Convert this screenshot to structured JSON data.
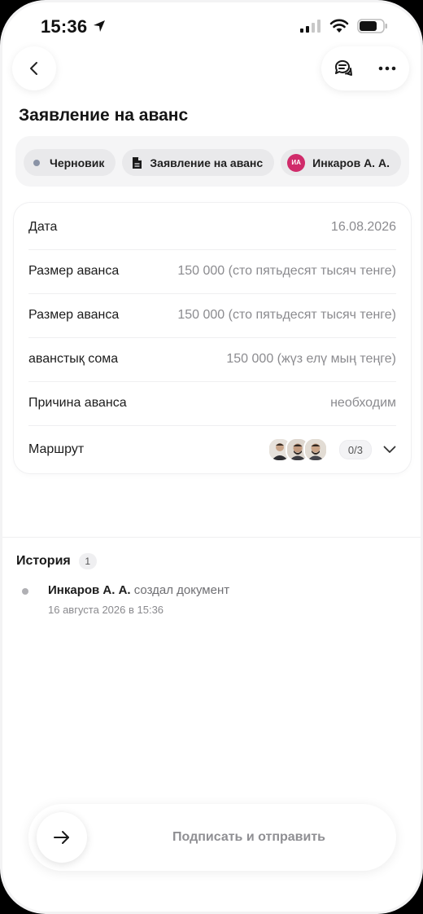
{
  "status_bar": {
    "time": "15:36"
  },
  "header": {
    "title": "Заявление на аванс"
  },
  "chips": {
    "status": "Черновик",
    "doc_type": "Заявление на аванс",
    "author_initials": "ИА",
    "author": "Инкаров А. А."
  },
  "details": {
    "rows": [
      {
        "label": "Дата",
        "value": "16.08.2026"
      },
      {
        "label": "Размер аванса",
        "value": "150 000 (сто пятьдесят тысяч тенге)"
      },
      {
        "label": "Размер аванса",
        "value": "150 000 (сто пятьдесят тысяч тенге)"
      },
      {
        "label": "аванстық сома",
        "value": "150 000 (жүз елү мың теңге)"
      },
      {
        "label": "Причина аванса",
        "value": "необходим"
      }
    ],
    "route": {
      "label": "Маршрут",
      "counter": "0/3"
    }
  },
  "history": {
    "title": "История",
    "count": "1",
    "items": [
      {
        "actor": "Инкаров А. А.",
        "action": "создал документ",
        "time": "16 августа 2026 в 15:36"
      }
    ]
  },
  "footer": {
    "sign_label": "Подписать и отправить"
  },
  "colors": {
    "accent_avatar": "#d02b6a",
    "status_dot": "#8a93a6"
  }
}
